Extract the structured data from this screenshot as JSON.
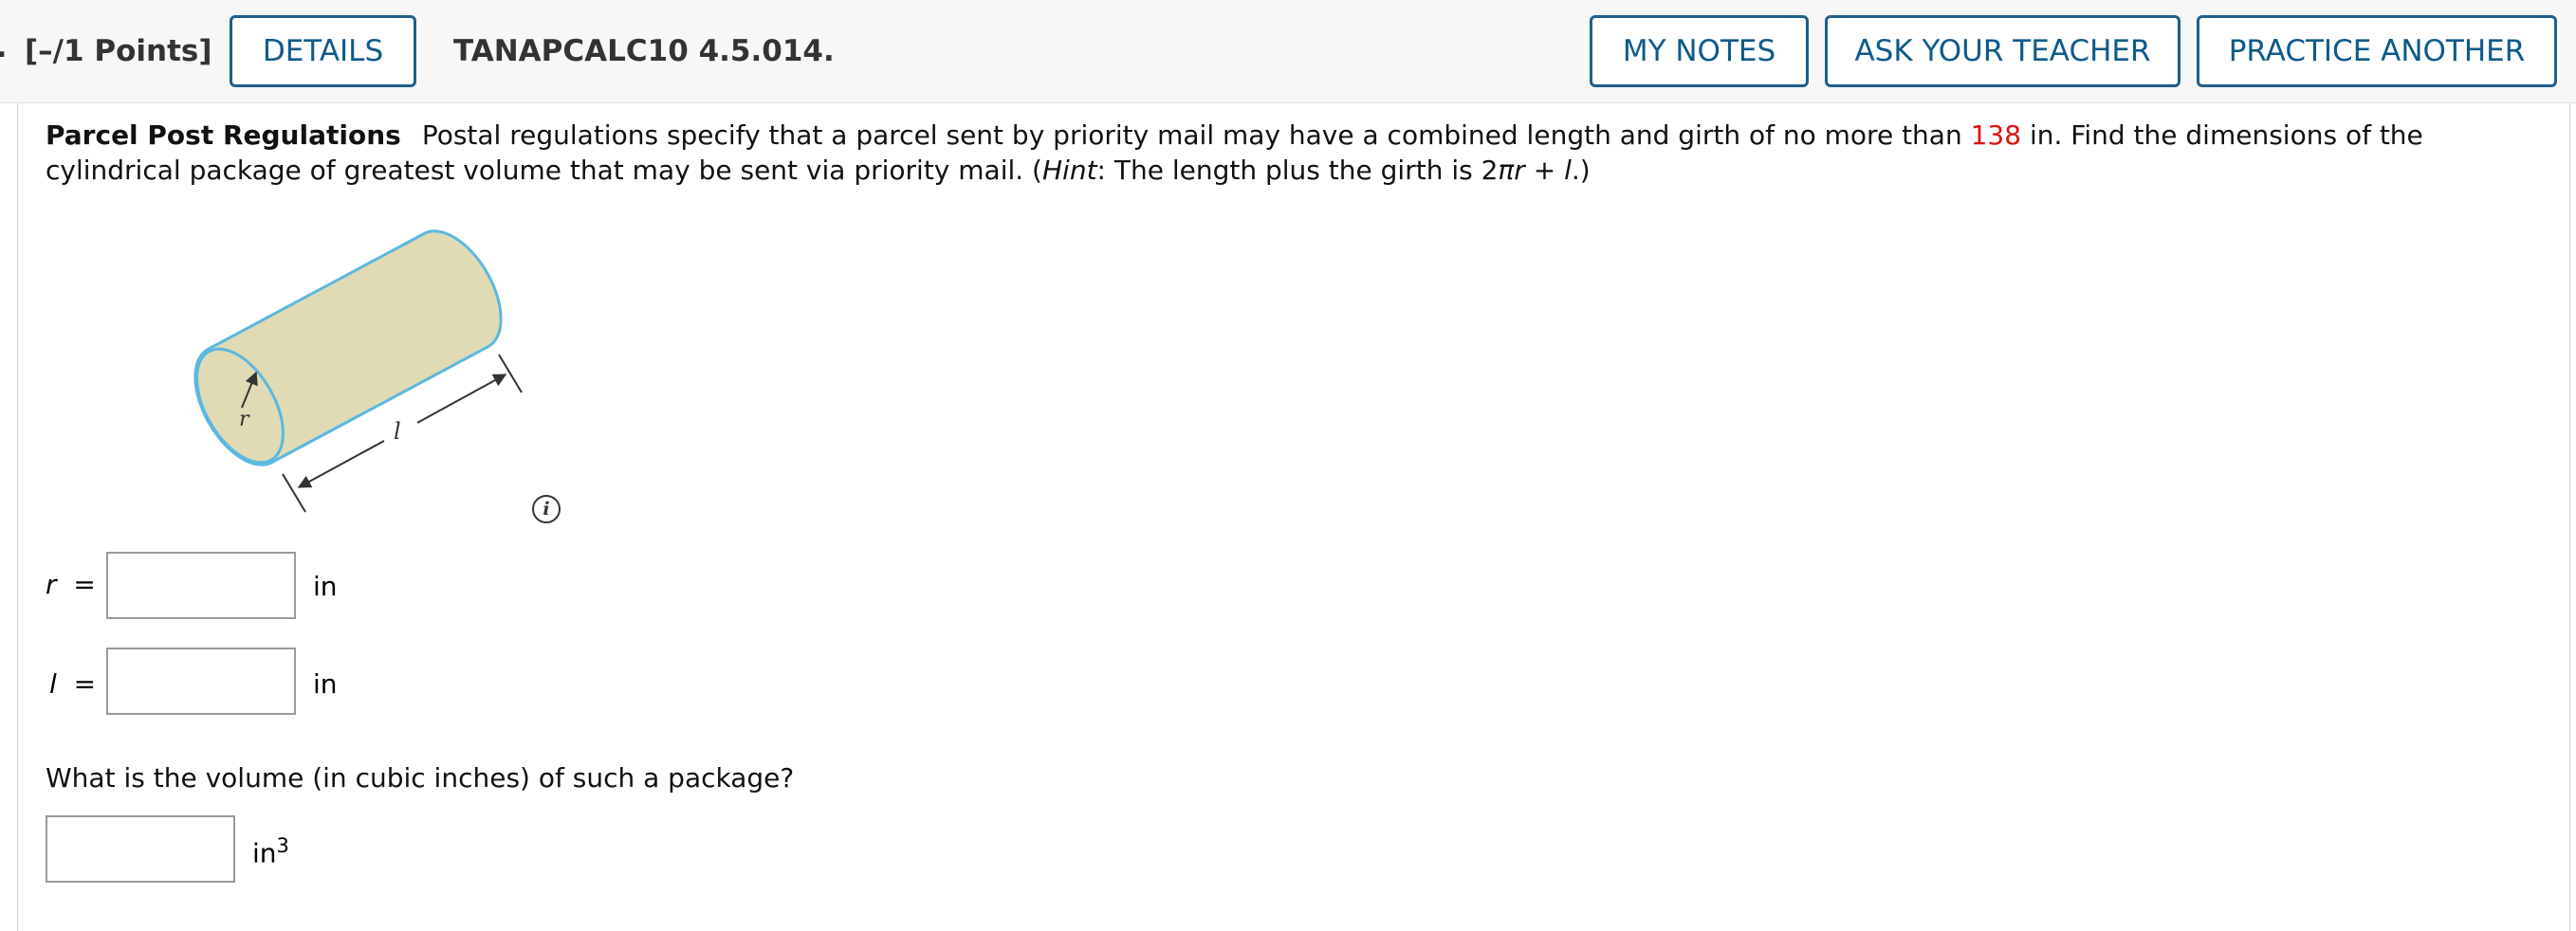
{
  "header": {
    "number_fragment": ".",
    "points": "[–/1 Points]",
    "details_label": "DETAILS",
    "problem_code": "TANAPCALC10 4.5.014.",
    "my_notes_label": "MY NOTES",
    "ask_teacher_label": "ASK YOUR TEACHER",
    "practice_another_label": "PRACTICE ANOTHER"
  },
  "problem": {
    "title": "Parcel Post Regulations",
    "text_before_value": "Postal regulations specify that a parcel sent by priority mail may have a combined length and girth of no more than ",
    "highlight_value": "138",
    "text_after_value": " in. Find the dimensions of the cylindrical package of greatest volume that may be sent via priority mail. (",
    "hint_label": "Hint",
    "hint_text_start": ": The length plus the girth is 2",
    "hint_expression": "πr",
    "hint_plus": " + ",
    "hint_l": "l",
    "hint_text_end": ".)"
  },
  "figure": {
    "radius_label": "r",
    "length_label": "l",
    "info_icon_glyph": "i",
    "fill_color": "#e0dab5",
    "stroke_color": "#5bb8e0"
  },
  "answers": {
    "r_var": "r",
    "r_equals": "=",
    "r_value": "",
    "r_unit": "in",
    "l_var": "l",
    "l_equals": "=",
    "l_value": "",
    "l_unit": "in",
    "volume_question": "What is the volume (in cubic inches) of such a package?",
    "volume_value": "",
    "volume_unit": "in",
    "volume_unit_exp": "3"
  }
}
